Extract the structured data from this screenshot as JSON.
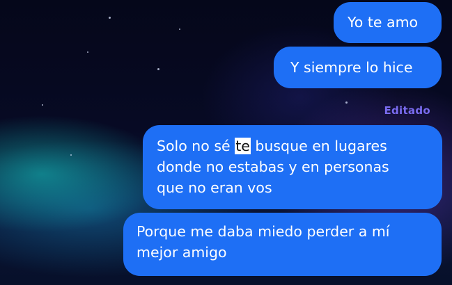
{
  "chat": {
    "messages": [
      {
        "lines": [
          "Yo te amo"
        ]
      },
      {
        "lines": [
          "Y siempre lo hice"
        ]
      },
      {
        "edited_label": "Editado",
        "line1_before": "Solo no sé",
        "line1_highlight": "te",
        "line1_after": "busque en lugares",
        "line2": "donde no estabas y en personas",
        "line3": "que no eran vos"
      },
      {
        "lines": [
          "Porque me daba miedo perder a mí",
          "mejor amigo"
        ]
      }
    ]
  },
  "colors": {
    "bubble": "#1e6ff5",
    "edited_label": "#7a6cf0",
    "highlight": "#ffffff"
  }
}
